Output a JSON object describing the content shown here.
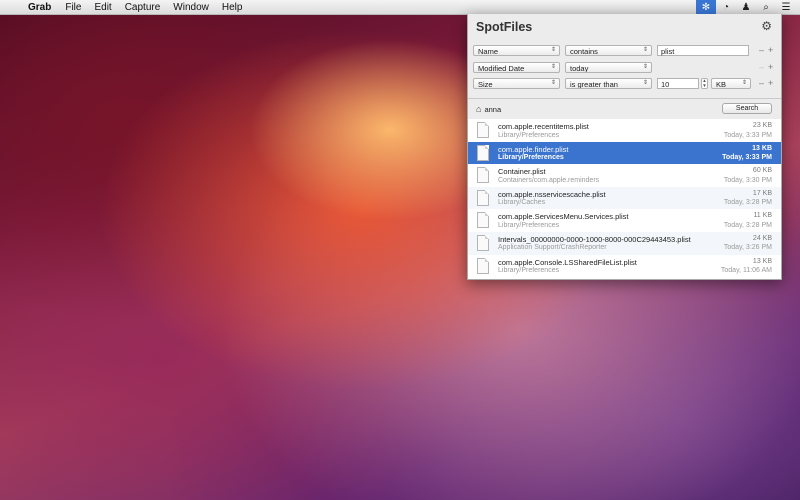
{
  "menubar": {
    "apple": "",
    "app_name": "Grab",
    "menus": [
      "File",
      "Edit",
      "Capture",
      "Window",
      "Help"
    ],
    "status_icons": [
      "spotfiles-gear-icon",
      "gauge-icon",
      "user-icon",
      "spotlight-search-icon",
      "list-icon"
    ]
  },
  "panel": {
    "title": "SpotFiles",
    "criteria": [
      {
        "attribute": "Name",
        "operator": "contains",
        "value": "plist"
      },
      {
        "attribute": "Modified Date",
        "operator": "today"
      },
      {
        "attribute": "Size",
        "operator": "is greater than",
        "value": "10",
        "unit": "KB"
      }
    ],
    "scope": "anna",
    "search_label": "Search",
    "results": [
      {
        "name": "com.apple.recentitems.plist",
        "path": "Library/Preferences",
        "size": "23 KB",
        "date": "Today, 3:33 PM"
      },
      {
        "name": "com.apple.finder.plist",
        "path": "Library/Preferences",
        "size": "13 KB",
        "date": "Today, 3:33 PM"
      },
      {
        "name": "Container.plist",
        "path": "Containers/com.apple.reminders",
        "size": "60 KB",
        "date": "Today, 3:30 PM"
      },
      {
        "name": "com.apple.nsservicescache.plist",
        "path": "Library/Caches",
        "size": "17 KB",
        "date": "Today, 3:28 PM"
      },
      {
        "name": "com.apple.ServicesMenu.Services.plist",
        "path": "Library/Preferences",
        "size": "11 KB",
        "date": "Today, 3:28 PM"
      },
      {
        "name": "Intervals_00000000-0000-1000-8000-000C29443453.plist",
        "path": "Application Support/CrashReporter",
        "size": "24 KB",
        "date": "Today, 3:26 PM"
      },
      {
        "name": "com.apple.Console.LSSharedFileList.plist",
        "path": "Library/Preferences",
        "size": "13 KB",
        "date": "Today, 11:06 AM"
      }
    ]
  },
  "colors": {
    "selection": "#3b74cf",
    "menubar_active": "#3a76d6"
  }
}
